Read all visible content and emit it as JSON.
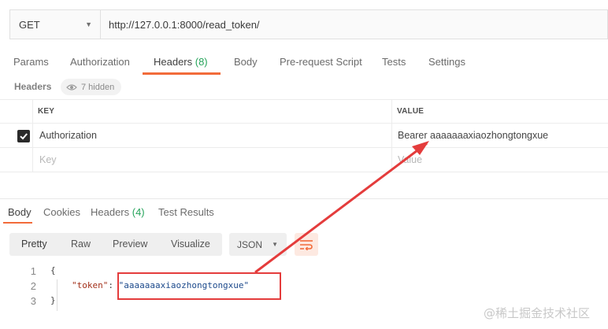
{
  "request": {
    "method": "GET",
    "url": "http://127.0.0.1:8000/read_token/"
  },
  "request_tabs": [
    {
      "label": "Params",
      "count": ""
    },
    {
      "label": "Authorization",
      "count": ""
    },
    {
      "label": "Headers ",
      "count": "(8)"
    },
    {
      "label": "Body",
      "count": ""
    },
    {
      "label": "Pre-request Script",
      "count": ""
    },
    {
      "label": "Tests",
      "count": ""
    },
    {
      "label": "Settings",
      "count": ""
    }
  ],
  "headers_section": {
    "title": "Headers",
    "hidden_label": "7 hidden"
  },
  "headers_table": {
    "columns": [
      "KEY",
      "VALUE"
    ],
    "rows": [
      {
        "checked": true,
        "key": "Authorization",
        "value": "Bearer aaaaaaaxiaozhongtongxue"
      }
    ],
    "placeholder": {
      "key": "Key",
      "value": "Value"
    }
  },
  "response_tabs": [
    {
      "label": "Body",
      "count": ""
    },
    {
      "label": "Cookies",
      "count": ""
    },
    {
      "label": "Headers ",
      "count": "(4)"
    },
    {
      "label": "Test Results",
      "count": ""
    }
  ],
  "format_toolbar": {
    "buttons": [
      "Pretty",
      "Raw",
      "Preview",
      "Visualize"
    ],
    "type_select": "JSON"
  },
  "response_body": {
    "line_numbers": [
      "1",
      "2",
      "3"
    ],
    "open_brace": "{",
    "key": "\"token\"",
    "colon": ": ",
    "value": "\"aaaaaaaxiaozhongtongxue\"",
    "close_brace": "}"
  },
  "colors": {
    "accent": "#f26b3a",
    "count_green": "#25a35a",
    "annotation_red": "#e43c3c"
  },
  "watermark": "@稀土掘金技术社区"
}
